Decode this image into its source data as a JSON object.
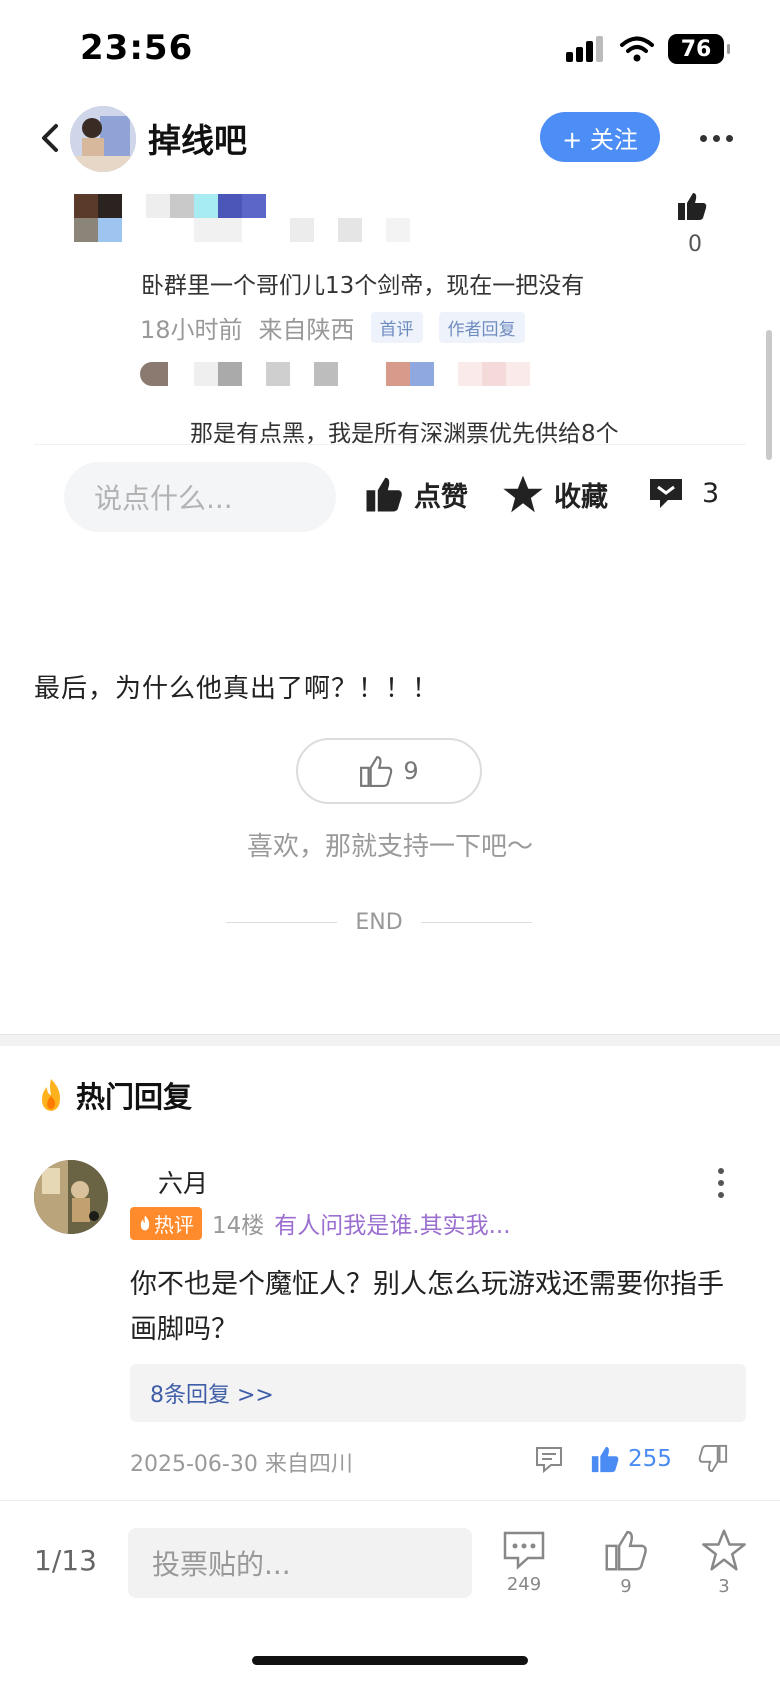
{
  "status_bar": {
    "time": "23:56",
    "battery": "76"
  },
  "header": {
    "forum_name": "掉线吧",
    "follow_label": "+ 关注"
  },
  "sub_comment": {
    "like_count": "0",
    "text": "卧群里一个哥们儿13个剑帝，现在一把没有",
    "time": "18小时前",
    "location": "来自陕西",
    "tags": [
      "首评",
      "作者回复"
    ],
    "reply_text": "那是有点黑，我是所有深渊票优先供给8个"
  },
  "action_bar": {
    "input_placeholder": "说点什么...",
    "like_label": "点赞",
    "favorite_label": "收藏",
    "comment_count": "3"
  },
  "post": {
    "last_line": "最后，为什么他真出了啊？！！！",
    "like_count": "9",
    "support_text": "喜欢，那就支持一下吧～",
    "end_label": "END"
  },
  "hot_replies": {
    "title": "热门回复",
    "reply": {
      "username": "六月",
      "badge": "热评",
      "floor": "14楼",
      "signature": "有人问我是谁.其实我...",
      "text": "你不也是个魔怔人？别人怎么玩游戏还需要你指手画脚吗？",
      "sub_replies_label": "8条回复 >>",
      "date_location": "2025-06-30 来自四川",
      "like_count": "255"
    }
  },
  "bottom_bar": {
    "page_indicator": "1/13",
    "input_placeholder": "投票贴的...",
    "comment_count": "249",
    "like_count": "9",
    "favorite_count": "3"
  },
  "colors": {
    "accent": "#4c8ef5",
    "hot_badge": "#ff8b2c",
    "signature": "#9a6fd0"
  }
}
